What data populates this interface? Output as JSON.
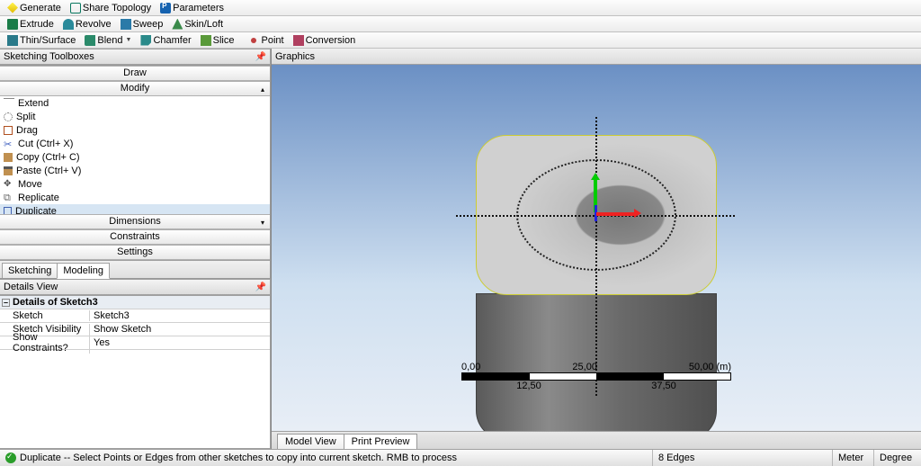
{
  "toolbar1": {
    "generate": "Generate",
    "share_topology": "Share Topology",
    "parameters": "Parameters"
  },
  "toolbar2": {
    "extrude": "Extrude",
    "revolve": "Revolve",
    "sweep": "Sweep",
    "skin_loft": "Skin/Loft"
  },
  "toolbar3": {
    "thin_surface": "Thin/Surface",
    "blend": "Blend",
    "chamfer": "Chamfer",
    "slice": "Slice",
    "point": "Point",
    "conversion": "Conversion"
  },
  "panes": {
    "sketch_toolbox": "Sketching Toolboxes",
    "details_view": "Details View",
    "graphics": "Graphics"
  },
  "stb_sections": {
    "draw": "Draw",
    "modify": "Modify",
    "dimensions": "Dimensions",
    "constraints": "Constraints",
    "settings": "Settings"
  },
  "modify_items": {
    "extend": "Extend",
    "split": "Split",
    "drag": "Drag",
    "cut": "Cut (Ctrl+ X)",
    "copy": "Copy (Ctrl+ C)",
    "paste": "Paste (Ctrl+ V)",
    "move": "Move",
    "replicate": "Replicate",
    "duplicate": "Duplicate"
  },
  "stb_tabs": {
    "sketching": "Sketching",
    "modeling": "Modeling"
  },
  "details": {
    "header": "Details of Sketch3",
    "rows": [
      {
        "k": "Sketch",
        "v": "Sketch3"
      },
      {
        "k": "Sketch Visibility",
        "v": "Show Sketch"
      },
      {
        "k": "Show Constraints?",
        "v": "Yes"
      }
    ]
  },
  "graphics_tabs": {
    "model_view": "Model View",
    "print_preview": "Print Preview"
  },
  "scale": {
    "a": "0,00",
    "b": "25,00",
    "c": "50,00 (m)",
    "d": "12,50",
    "e": "37,50"
  },
  "status": {
    "msg": "Duplicate -- Select Points or Edges from other sketches to copy into current sketch. RMB to process",
    "sel": "8 Edges",
    "unit1": "Meter",
    "unit2": "Degree"
  }
}
